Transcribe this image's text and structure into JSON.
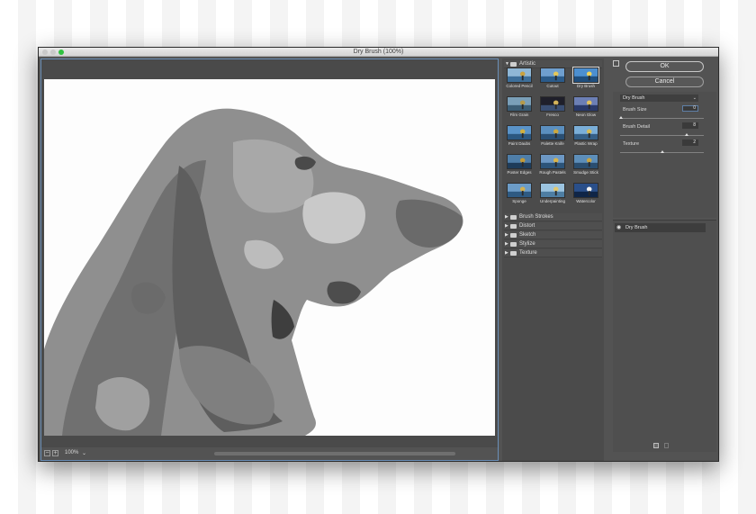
{
  "window": {
    "title": "Dry Brush (100%)"
  },
  "preview": {
    "zoom_label": "100%",
    "zoom_out_symbol": "−",
    "zoom_in_symbol": "+",
    "zoom_dropdown": "⌄"
  },
  "gallery": {
    "open_category": "Artistic",
    "thumbs": [
      {
        "label": "Colored Pencil",
        "selected": false
      },
      {
        "label": "Cutout",
        "selected": false
      },
      {
        "label": "Dry Brush",
        "selected": true
      },
      {
        "label": "Film Grain",
        "selected": false
      },
      {
        "label": "Fresco",
        "selected": false
      },
      {
        "label": "Neon Glow",
        "selected": false
      },
      {
        "label": "Paint Daubs",
        "selected": false
      },
      {
        "label": "Palette Knife",
        "selected": false
      },
      {
        "label": "Plastic Wrap",
        "selected": false
      },
      {
        "label": "Poster Edges",
        "selected": false
      },
      {
        "label": "Rough Pastels",
        "selected": false
      },
      {
        "label": "Smudge Stick",
        "selected": false
      },
      {
        "label": "Sponge",
        "selected": false
      },
      {
        "label": "Underpainting",
        "selected": false
      },
      {
        "label": "Watercolor",
        "selected": false
      }
    ],
    "collapsed_categories": [
      "Brush Strokes",
      "Distort",
      "Sketch",
      "Stylize",
      "Texture"
    ]
  },
  "buttons": {
    "ok": "OK",
    "cancel": "Cancel"
  },
  "settings": {
    "filter": "Dry Brush",
    "brush_size": {
      "label": "Brush Size",
      "value": "0"
    },
    "brush_detail": {
      "label": "Brush Detail",
      "value": "8"
    },
    "texture": {
      "label": "Texture",
      "value": "2"
    }
  },
  "layers": {
    "items": [
      {
        "label": "Dry Brush"
      }
    ]
  },
  "colors": {
    "accent_border": "#6a8fb8",
    "panel": "#535353",
    "traffic_max": "#2fc240"
  }
}
